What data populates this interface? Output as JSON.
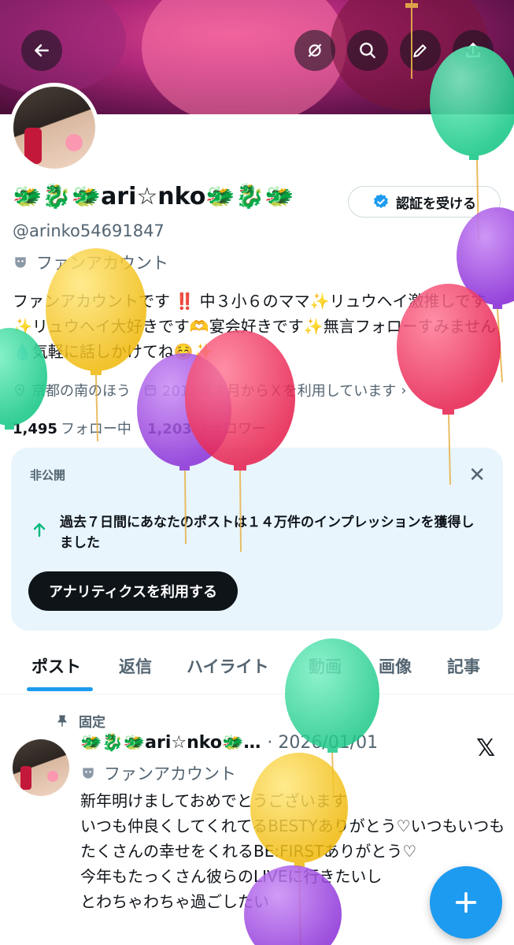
{
  "header": {
    "back_icon": "arrow-left-icon",
    "actions": [
      "no-grok-icon",
      "search-icon",
      "edit-icon",
      "share-icon"
    ]
  },
  "profile": {
    "name_prefix": "🐲🐉🐲",
    "name_core": "ari☆nko",
    "name_suffix": "🐲🐉🐲",
    "verify_button": "認証を受ける",
    "handle": "@arinko54691847",
    "account_type": "ファンアカウント",
    "bio": "ファンアカウントです ‼️ 中３小６のママ✨リュウヘイ激推しです✨リュウヘイ大好きです🫶宴会好きです✨無言フォローすみません💧気軽に話しかけてね☺️✨",
    "location": "京都の南のほう",
    "joined": "2011年３月からＸを利用しています",
    "following_count": "1,495",
    "following_label": "フォロー中",
    "followers_count": "1,203",
    "followers_label": "フォロワー"
  },
  "analytics_card": {
    "label": "非公開",
    "message": "過去７日間にあなたのポストは１４万件のインプレッションを獲得しました",
    "cta": "アナリティクスを利用する"
  },
  "tabs": [
    "ポスト",
    "返信",
    "ハイライト",
    "動画",
    "画像",
    "記事"
  ],
  "post": {
    "pinned_label": "固定",
    "name": "🐲🐉🐲ari☆nko🐲…",
    "date": "· 2026/01/01",
    "account_type": "ファンアカウント",
    "text": "新年明けましておめでとうございます\nいつも仲良くしてくれてるBESTYありがとう♡いつもいつもたくさんの幸せをくれるBE:FIRSTありがとう♡\n今年もたっくさん彼らのLIVEに行きたいし\nとわちゃわちゃ過ごしたい"
  },
  "fab": {
    "icon": "plus-icon"
  },
  "colors": {
    "accent": "#1d9bf0",
    "text": "#0f1419",
    "muted": "#536471",
    "card_bg": "#e8f5fd"
  }
}
